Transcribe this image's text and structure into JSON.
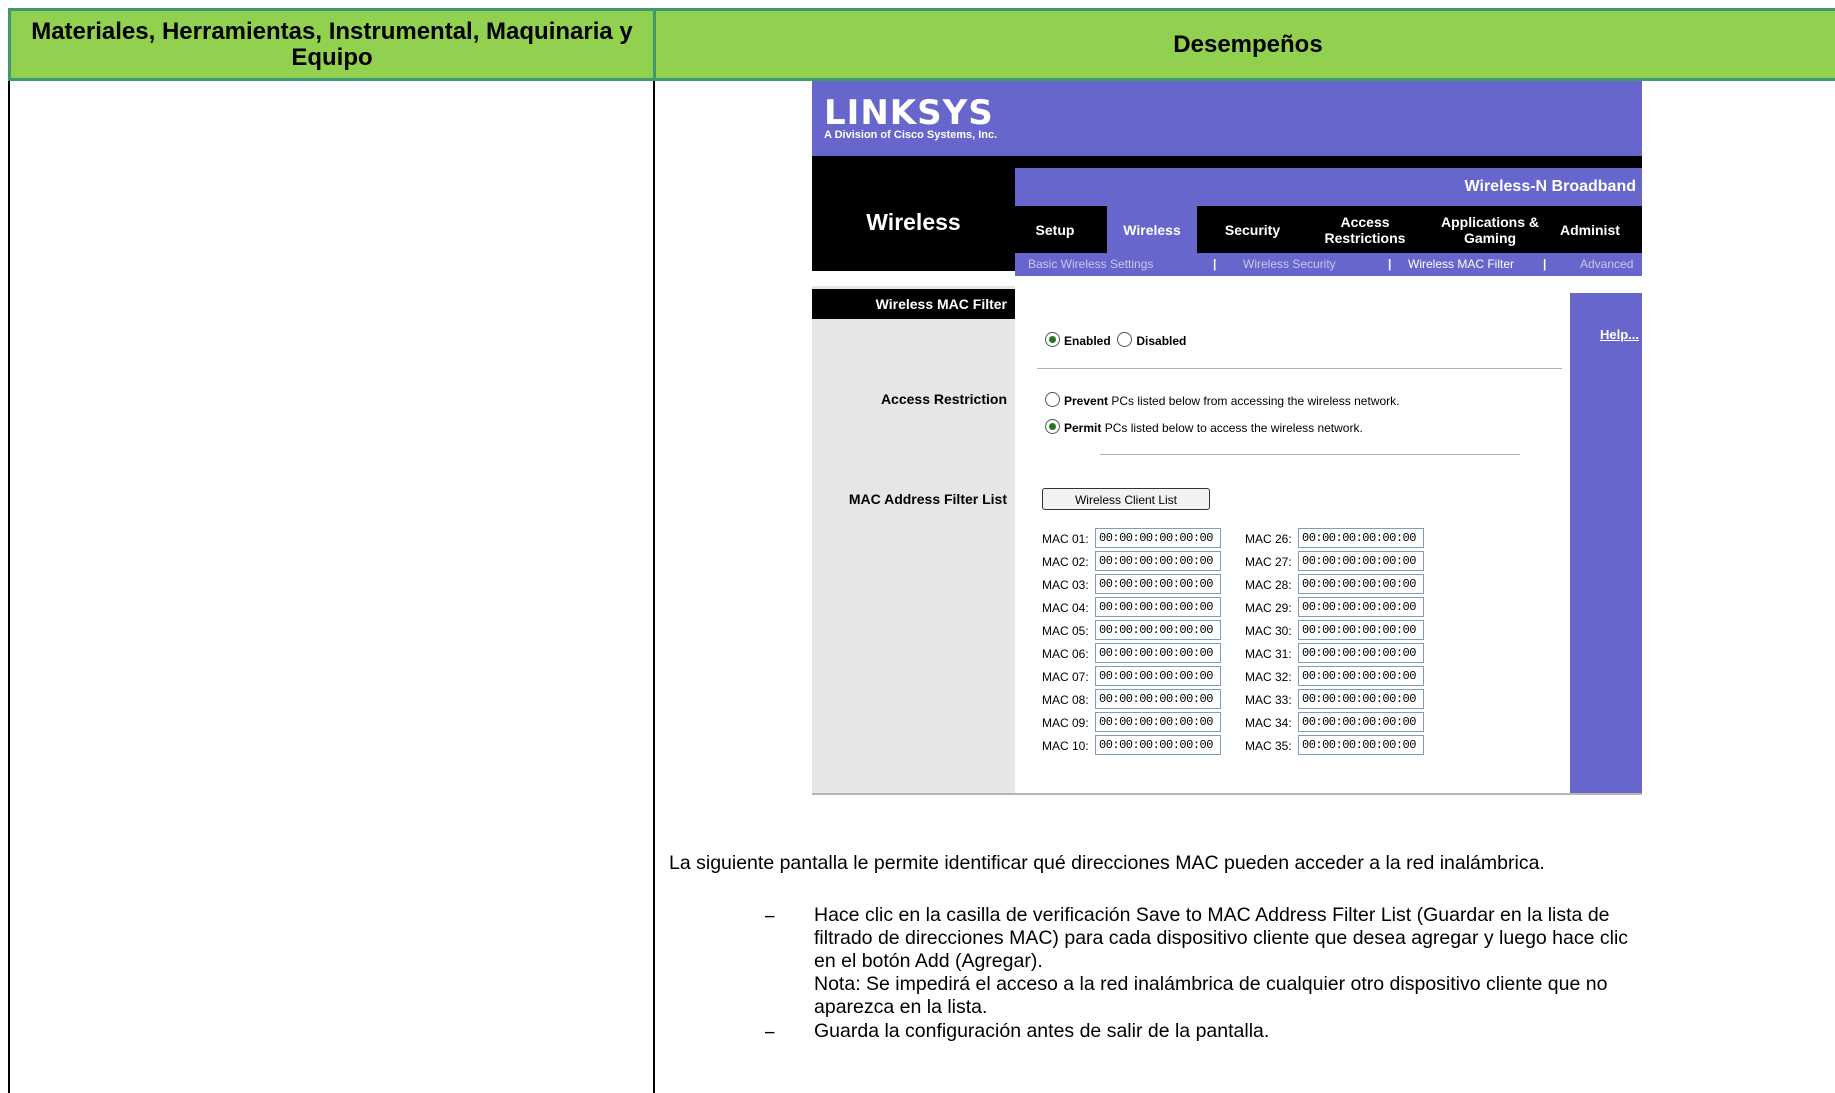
{
  "table": {
    "header_left": "Materiales, Herramientas, Instrumental, Maquinaria y Equipo",
    "header_right": "Desempeños"
  },
  "colors": {
    "header_bg": "#92d050",
    "linksys_purple": "#6666cc"
  },
  "router": {
    "logo": "LINKSYS",
    "logo_sub": "A Division of Cisco Systems, Inc.",
    "product": "Wireless-N Broadband",
    "section_title": "Wireless",
    "tabs": [
      "Setup",
      "Wireless",
      "Security",
      "Access Restrictions",
      "Applications & Gaming",
      "Administ"
    ],
    "subtabs": [
      "Basic Wireless Settings",
      "Wireless Security",
      "Wireless MAC Filter",
      "Advanced"
    ],
    "side_title": "Wireless MAC Filter",
    "help": "Help...",
    "status_options": [
      "Enabled",
      "Disabled"
    ],
    "access_restriction_label": "Access Restriction",
    "prevent_bold": "Prevent",
    "prevent_text": "PCs listed below from accessing the wireless network.",
    "permit_bold": "Permit",
    "permit_text": "PCs listed below to access the wireless network.",
    "mac_list_label": "MAC Address Filter List",
    "client_list_button": "Wireless Client List",
    "mac_left": [
      {
        "label": "MAC 01:",
        "value": "00:00:00:00:00:00"
      },
      {
        "label": "MAC 02:",
        "value": "00:00:00:00:00:00"
      },
      {
        "label": "MAC 03:",
        "value": "00:00:00:00:00:00"
      },
      {
        "label": "MAC 04:",
        "value": "00:00:00:00:00:00"
      },
      {
        "label": "MAC 05:",
        "value": "00:00:00:00:00:00"
      },
      {
        "label": "MAC 06:",
        "value": "00:00:00:00:00:00"
      },
      {
        "label": "MAC 07:",
        "value": "00:00:00:00:00:00"
      },
      {
        "label": "MAC 08:",
        "value": "00:00:00:00:00:00"
      },
      {
        "label": "MAC 09:",
        "value": "00:00:00:00:00:00"
      },
      {
        "label": "MAC 10:",
        "value": "00:00:00:00:00:00"
      }
    ],
    "mac_right": [
      {
        "label": "MAC 26:",
        "value": "00:00:00:00:00:00"
      },
      {
        "label": "MAC 27:",
        "value": "00:00:00:00:00:00"
      },
      {
        "label": "MAC 28:",
        "value": "00:00:00:00:00:00"
      },
      {
        "label": "MAC 29:",
        "value": "00:00:00:00:00:00"
      },
      {
        "label": "MAC 30:",
        "value": "00:00:00:00:00:00"
      },
      {
        "label": "MAC 31:",
        "value": "00:00:00:00:00:00"
      },
      {
        "label": "MAC 32:",
        "value": "00:00:00:00:00:00"
      },
      {
        "label": "MAC 33:",
        "value": "00:00:00:00:00:00"
      },
      {
        "label": "MAC 34:",
        "value": "00:00:00:00:00:00"
      },
      {
        "label": "MAC 35:",
        "value": "00:00:00:00:00:00"
      }
    ]
  },
  "text": {
    "intro": "La siguiente pantalla le permite identificar qué direcciones MAC pueden acceder a la red inalámbrica.",
    "bullet1_line1": "Hace clic en la casilla de verificación Save to MAC Address Filter List (Guardar en la lista de",
    "bullet1_line2": "filtrado de direcciones MAC) para cada dispositivo cliente que desea agregar y luego hace clic",
    "bullet1_line3": "en el botón Add (Agregar).",
    "note_line1": "Nota: Se impedirá el acceso a la red inalámbrica de cualquier otro dispositivo cliente que no",
    "note_line2": "aparezca en la lista.",
    "bullet2": "Guarda la configuración antes de salir de la pantalla.",
    "dash": "−"
  }
}
